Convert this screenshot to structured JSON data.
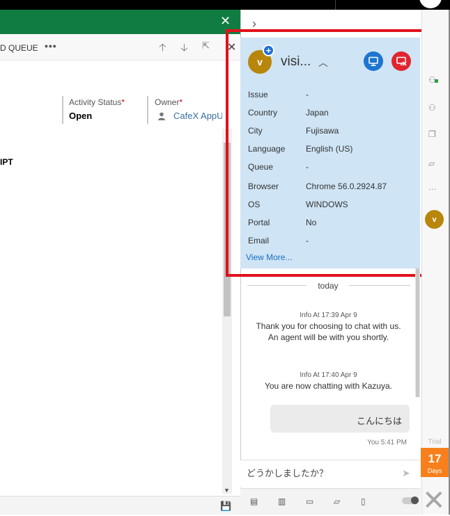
{
  "crm": {
    "cmd_queue_label": "D QUEUE",
    "cmd_more": "•••",
    "fields": {
      "activity_status_label": "Activity Status",
      "activity_status_value": "Open",
      "owner_label": "Owner",
      "owner_value": "CafeX AppU",
      "required_mark": "*"
    },
    "section_heading": "IPT"
  },
  "visitor": {
    "avatar_initial": "v",
    "name": "visi...",
    "details": [
      {
        "label": "Issue",
        "value": "-"
      },
      {
        "label": "Country",
        "value": "Japan"
      },
      {
        "label": "City",
        "value": "Fujisawa"
      },
      {
        "label": "Language",
        "value": "English (US)"
      },
      {
        "label": "Queue",
        "value": "-"
      },
      {
        "label": "Browser",
        "value": "Chrome 56.0.2924.87"
      },
      {
        "label": "OS",
        "value": "WINDOWS"
      },
      {
        "label": "Portal",
        "value": "No"
      },
      {
        "label": "Email",
        "value": "-"
      }
    ],
    "view_more": "View More..."
  },
  "chat": {
    "day_label": "today",
    "messages": [
      {
        "meta": "Info At 17:39 Apr 9",
        "line1": "Thank you for choosing to chat with us.",
        "line2": "An agent will be with you shortly."
      },
      {
        "meta": "Info At 17:40 Apr 9",
        "line1": "You are now chatting with Kazuya."
      }
    ],
    "agent_message": {
      "text": "こんにちは",
      "meta": "You 5:41 PM"
    },
    "compose_value": "どうかしましたか？"
  },
  "trial": {
    "label": "Trial",
    "days_number": "17",
    "days_label": "Days"
  },
  "rail": {
    "avatar_initial": "v"
  },
  "colors": {
    "crm_green": "#107c41",
    "card_blue": "#cfe4f5",
    "share_blue": "#1d75cf",
    "end_red": "#e1242e",
    "highlight_red": "#e0111b",
    "trial_orange": "#f7801c",
    "avatar_gold": "#b8860b"
  }
}
